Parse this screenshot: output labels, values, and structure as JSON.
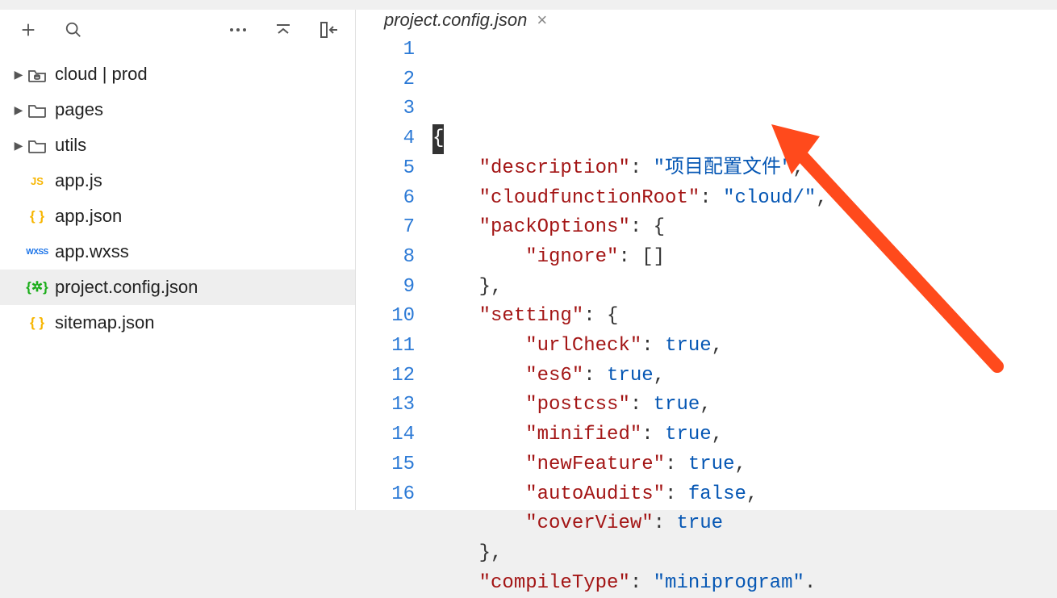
{
  "tab": {
    "filename": "project.config.json"
  },
  "tree": {
    "items": [
      {
        "label": "cloud | prod",
        "kind": "folder-cloud",
        "caret": true
      },
      {
        "label": "pages",
        "kind": "folder",
        "caret": true
      },
      {
        "label": "utils",
        "kind": "folder",
        "caret": true
      },
      {
        "label": "app.js",
        "kind": "js"
      },
      {
        "label": "app.json",
        "kind": "json"
      },
      {
        "label": "app.wxss",
        "kind": "wxss"
      },
      {
        "label": "project.config.json",
        "kind": "config",
        "active": true
      },
      {
        "label": "sitemap.json",
        "kind": "json"
      }
    ]
  },
  "code": {
    "lines": [
      {
        "n": "1",
        "tokens": [
          {
            "t": "cursor",
            "v": "{"
          }
        ]
      },
      {
        "n": "2",
        "tokens": [
          {
            "t": "ind",
            "v": "    "
          },
          {
            "t": "key",
            "v": "\"description\""
          },
          {
            "t": "punc",
            "v": ": "
          },
          {
            "t": "str",
            "v": "\"项目配置文件\""
          },
          {
            "t": "punc",
            "v": ","
          }
        ]
      },
      {
        "n": "3",
        "tokens": [
          {
            "t": "ind",
            "v": "    "
          },
          {
            "t": "key",
            "v": "\"cloudfunctionRoot\""
          },
          {
            "t": "punc",
            "v": ": "
          },
          {
            "t": "str",
            "v": "\"cloud/\""
          },
          {
            "t": "punc",
            "v": ","
          }
        ]
      },
      {
        "n": "4",
        "tokens": [
          {
            "t": "ind",
            "v": "    "
          },
          {
            "t": "key",
            "v": "\"packOptions\""
          },
          {
            "t": "punc",
            "v": ": {"
          }
        ]
      },
      {
        "n": "5",
        "tokens": [
          {
            "t": "ind",
            "v": "        "
          },
          {
            "t": "key",
            "v": "\"ignore\""
          },
          {
            "t": "punc",
            "v": ": []"
          }
        ]
      },
      {
        "n": "6",
        "tokens": [
          {
            "t": "ind",
            "v": "    "
          },
          {
            "t": "punc",
            "v": "},"
          }
        ]
      },
      {
        "n": "7",
        "tokens": [
          {
            "t": "ind",
            "v": "    "
          },
          {
            "t": "key",
            "v": "\"setting\""
          },
          {
            "t": "punc",
            "v": ": {"
          }
        ]
      },
      {
        "n": "8",
        "tokens": [
          {
            "t": "ind",
            "v": "        "
          },
          {
            "t": "key",
            "v": "\"urlCheck\""
          },
          {
            "t": "punc",
            "v": ": "
          },
          {
            "t": "bool",
            "v": "true"
          },
          {
            "t": "punc",
            "v": ","
          }
        ]
      },
      {
        "n": "9",
        "tokens": [
          {
            "t": "ind",
            "v": "        "
          },
          {
            "t": "key",
            "v": "\"es6\""
          },
          {
            "t": "punc",
            "v": ": "
          },
          {
            "t": "bool",
            "v": "true"
          },
          {
            "t": "punc",
            "v": ","
          }
        ]
      },
      {
        "n": "10",
        "tokens": [
          {
            "t": "ind",
            "v": "        "
          },
          {
            "t": "key",
            "v": "\"postcss\""
          },
          {
            "t": "punc",
            "v": ": "
          },
          {
            "t": "bool",
            "v": "true"
          },
          {
            "t": "punc",
            "v": ","
          }
        ]
      },
      {
        "n": "11",
        "tokens": [
          {
            "t": "ind",
            "v": "        "
          },
          {
            "t": "key",
            "v": "\"minified\""
          },
          {
            "t": "punc",
            "v": ": "
          },
          {
            "t": "bool",
            "v": "true"
          },
          {
            "t": "punc",
            "v": ","
          }
        ]
      },
      {
        "n": "12",
        "tokens": [
          {
            "t": "ind",
            "v": "        "
          },
          {
            "t": "key",
            "v": "\"newFeature\""
          },
          {
            "t": "punc",
            "v": ": "
          },
          {
            "t": "bool",
            "v": "true"
          },
          {
            "t": "punc",
            "v": ","
          }
        ]
      },
      {
        "n": "13",
        "tokens": [
          {
            "t": "ind",
            "v": "        "
          },
          {
            "t": "key",
            "v": "\"autoAudits\""
          },
          {
            "t": "punc",
            "v": ": "
          },
          {
            "t": "bool",
            "v": "false"
          },
          {
            "t": "punc",
            "v": ","
          }
        ]
      },
      {
        "n": "14",
        "tokens": [
          {
            "t": "ind",
            "v": "        "
          },
          {
            "t": "key",
            "v": "\"coverView\""
          },
          {
            "t": "punc",
            "v": ": "
          },
          {
            "t": "bool",
            "v": "true"
          }
        ]
      },
      {
        "n": "15",
        "tokens": [
          {
            "t": "ind",
            "v": "    "
          },
          {
            "t": "punc",
            "v": "},"
          }
        ]
      },
      {
        "n": "16",
        "tokens": [
          {
            "t": "ind",
            "v": "    "
          },
          {
            "t": "key",
            "v": "\"compileType\""
          },
          {
            "t": "punc",
            "v": ": "
          },
          {
            "t": "str",
            "v": "\"miniprogram\""
          },
          {
            "t": "punc",
            "v": "."
          }
        ]
      }
    ]
  }
}
